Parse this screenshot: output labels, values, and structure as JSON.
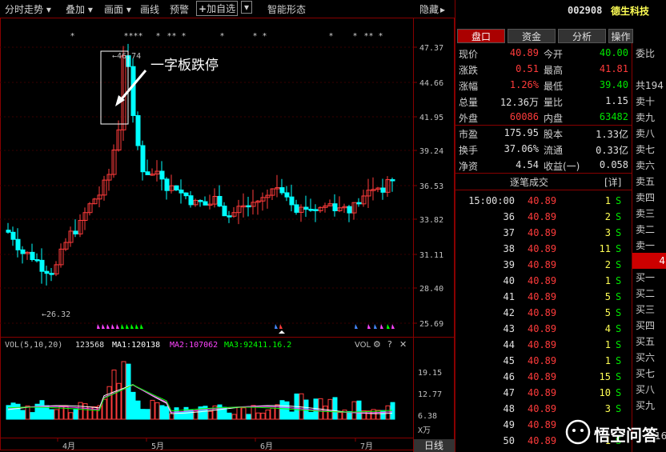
{
  "toolbar": {
    "items": [
      "分时走势",
      "叠加",
      "画面",
      "画线",
      "预警",
      "加自选",
      "智能形态",
      "隐藏"
    ]
  },
  "chart": {
    "price_axis": [
      "47.37",
      "44.66",
      "41.95",
      "39.24",
      "36.53",
      "33.82",
      "31.11",
      "28.40",
      "25.69"
    ],
    "vol_axis": [
      "19.15",
      "12.77",
      "6.38",
      "X万"
    ],
    "months": [
      "4月",
      "5月",
      "6月",
      "7月"
    ],
    "period": "日线",
    "high_label": "46.74",
    "low_label": "26.32",
    "annotation": "一字板跌停",
    "vol_legend": {
      "name": "VOL(5,10,20)",
      "vol": "123568",
      "ma1_label": "MA1:",
      "ma1": "120138",
      "ma2_label": "MA2:",
      "ma2": "107062",
      "ma3_label": "MA3:",
      "ma3": "92411.16.2",
      "tag": "VOL"
    },
    "colors": {
      "up": "#ff3b3b",
      "down": "#00ffff",
      "ma1": "#ffffff",
      "ma2": "#ff44ff",
      "ma3": "#00ff00"
    }
  },
  "quote": {
    "code": "002908",
    "name": "德生科技",
    "tabs": [
      "盘口",
      "资金",
      "分析",
      "操作"
    ],
    "rows": [
      {
        "l1": "现价",
        "v1": "40.89",
        "c1": "red",
        "l2": "今开",
        "v2": "40.00",
        "c2": "green"
      },
      {
        "l1": "涨跌",
        "v1": "0.51",
        "c1": "red",
        "l2": "最高",
        "v2": "41.81",
        "c2": "red"
      },
      {
        "l1": "涨幅",
        "v1": "1.26%",
        "c1": "red",
        "l2": "最低",
        "v2": "39.40",
        "c2": "green"
      },
      {
        "l1": "总量",
        "v1": "12.36万",
        "c1": "white",
        "l2": "量比",
        "v2": "1.15",
        "c2": "white"
      },
      {
        "l1": "外盘",
        "v1": "60086",
        "c1": "red",
        "l2": "内盘",
        "v2": "63482",
        "c2": "green"
      },
      {
        "l1": "市盈",
        "v1": "175.95",
        "c1": "white",
        "l2": "股本",
        "v2": "1.33亿",
        "c2": "white"
      },
      {
        "l1": "换手",
        "v1": "37.06%",
        "c1": "white",
        "l2": "流通",
        "v2": "0.33亿",
        "c2": "white"
      },
      {
        "l1": "净资",
        "v1": "4.54",
        "c1": "white",
        "l2": "收益(一)",
        "v2": "0.058",
        "c2": "white"
      }
    ],
    "trades_title": "逐笔成交",
    "trades_detail": "[详]",
    "trades": [
      {
        "t": "15:00:00",
        "p": "40.89",
        "v": "1",
        "s": "S"
      },
      {
        "t": "36",
        "p": "40.89",
        "v": "2",
        "s": "S"
      },
      {
        "t": "37",
        "p": "40.89",
        "v": "3",
        "s": "S"
      },
      {
        "t": "38",
        "p": "40.89",
        "v": "11",
        "s": "S"
      },
      {
        "t": "39",
        "p": "40.89",
        "v": "2",
        "s": "S"
      },
      {
        "t": "40",
        "p": "40.89",
        "v": "1",
        "s": "S"
      },
      {
        "t": "41",
        "p": "40.89",
        "v": "5",
        "s": "S"
      },
      {
        "t": "42",
        "p": "40.89",
        "v": "5",
        "s": "S"
      },
      {
        "t": "43",
        "p": "40.89",
        "v": "4",
        "s": "S"
      },
      {
        "t": "44",
        "p": "40.89",
        "v": "1",
        "s": "S"
      },
      {
        "t": "45",
        "p": "40.89",
        "v": "1",
        "s": "S"
      },
      {
        "t": "46",
        "p": "40.89",
        "v": "15",
        "s": "S"
      },
      {
        "t": "47",
        "p": "40.89",
        "v": "10",
        "s": "S"
      },
      {
        "t": "48",
        "p": "40.89",
        "v": "3",
        "s": "S"
      },
      {
        "t": "49",
        "p": "40.89",
        "v": "",
        "s": ""
      },
      {
        "t": "50",
        "p": "40.89",
        "v": "1",
        "s": "S"
      }
    ]
  },
  "book": {
    "title": "委比",
    "total": "共194",
    "asks": [
      "卖十",
      "卖九",
      "卖八",
      "卖七",
      "卖六",
      "卖五",
      "卖四",
      "卖三",
      "卖二",
      "卖一"
    ],
    "mid": "4",
    "bids": [
      "买一",
      "买二",
      "买三",
      "买四",
      "买五",
      "买六",
      "买七",
      "买八",
      "买九"
    ],
    "bottom": "16"
  },
  "watermark": "悟空问答"
}
